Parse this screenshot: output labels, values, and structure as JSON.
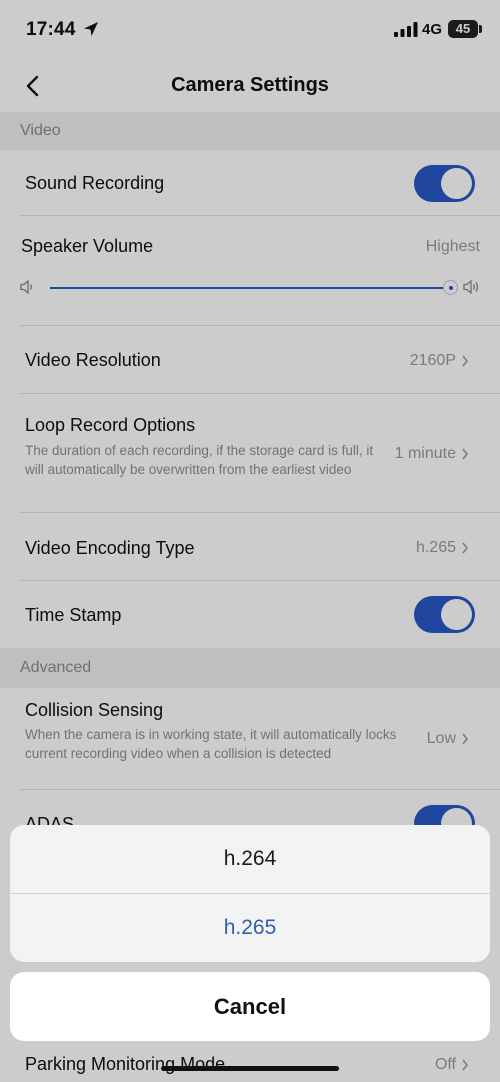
{
  "status_bar": {
    "time": "17:44",
    "network": "4G",
    "battery": "45"
  },
  "nav": {
    "title": "Camera Settings"
  },
  "sections": {
    "video": "Video",
    "advanced": "Advanced"
  },
  "rows": {
    "sound_recording": {
      "label": "Sound Recording",
      "enabled": true
    },
    "speaker_volume": {
      "label": "Speaker Volume",
      "value": "Highest",
      "level": 1.0
    },
    "video_resolution": {
      "label": "Video Resolution",
      "value": "2160P"
    },
    "loop_record": {
      "label": "Loop Record Options",
      "description": "The duration of each recording, if the storage card is full, it will automatically be overwritten from the earliest video",
      "value": "1 minute"
    },
    "video_encoding": {
      "label": "Video Encoding Type",
      "value": "h.265"
    },
    "time_stamp": {
      "label": "Time Stamp",
      "enabled": true
    },
    "collision_sensing": {
      "label": "Collision Sensing",
      "description": "When the camera is in working state, it will automatically locks current recording video when a collision is detected",
      "value": "Low"
    },
    "adas": {
      "label": "ADAS",
      "enabled": true
    },
    "parking_mode": {
      "label": "Parking Monitoring Mode",
      "value": "Off"
    }
  },
  "action_sheet": {
    "options": [
      "h.264",
      "h.265"
    ],
    "selected": "h.265",
    "cancel_label": "Cancel"
  },
  "colors": {
    "accent": "#2957c7",
    "selected_option": "#2f5fb0"
  }
}
